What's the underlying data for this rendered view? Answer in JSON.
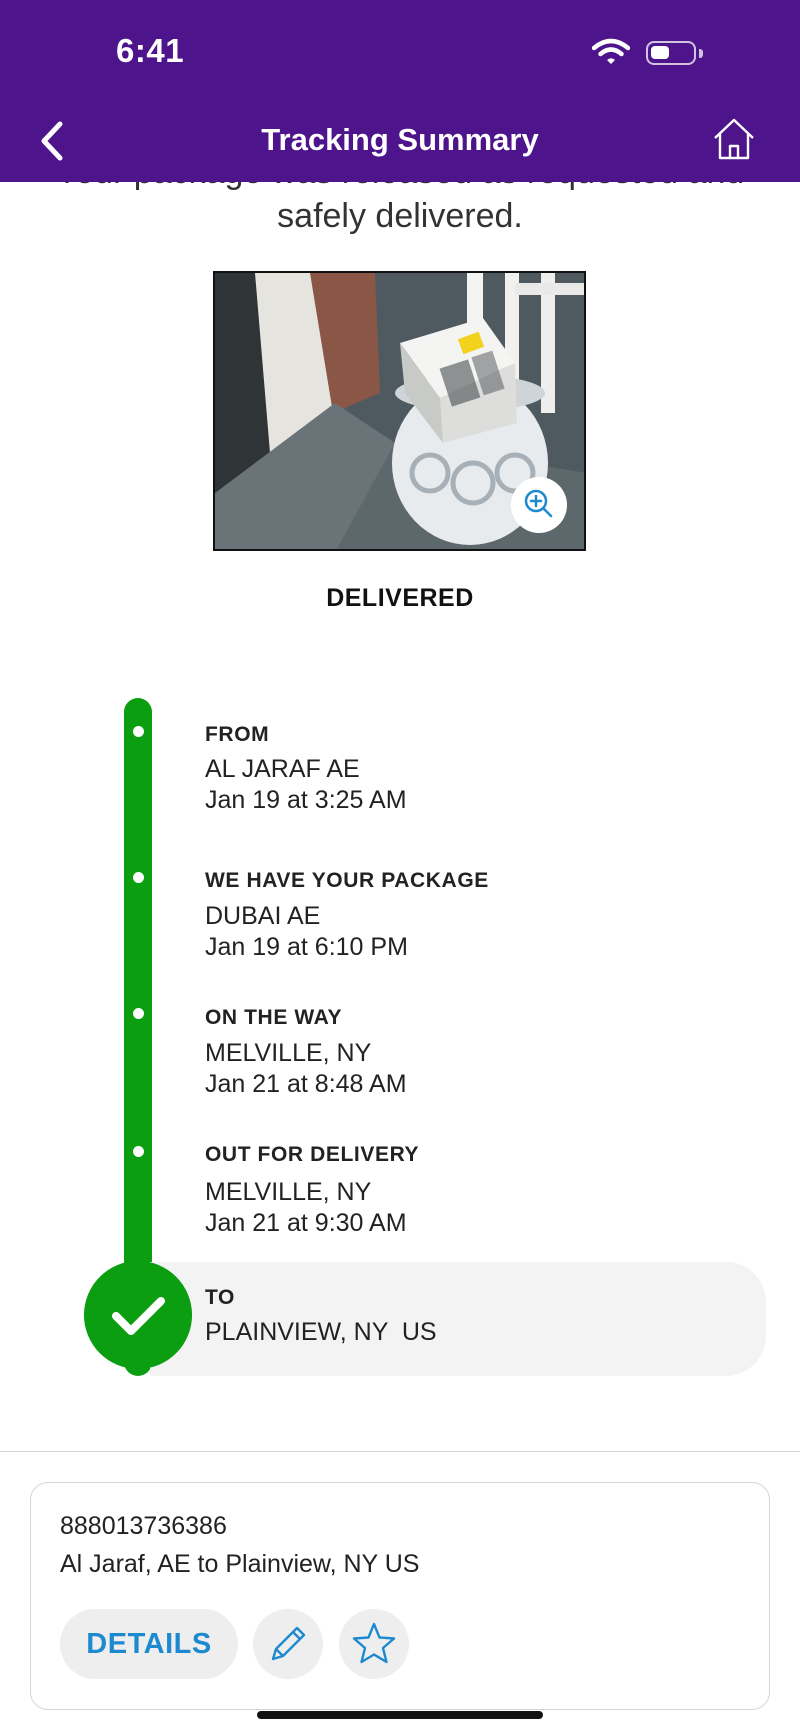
{
  "status_bar": {
    "time": "6:41"
  },
  "nav": {
    "title": "Tracking Summary",
    "back_icon": "chevron-left-icon",
    "home_icon": "home-icon"
  },
  "message": {
    "line1": "Your package was released as requested and",
    "line2": "safely delivered."
  },
  "photo": {
    "zoom_icon": "zoom-in-icon"
  },
  "status": "DELIVERED",
  "timeline": [
    {
      "heading": "FROM",
      "location": "AL JARAF AE",
      "time": "Jan 19 at 3:25 AM"
    },
    {
      "heading": "WE HAVE YOUR PACKAGE",
      "location": "DUBAI AE",
      "time": "Jan 19 at 6:10 PM"
    },
    {
      "heading": "ON THE WAY",
      "location": "MELVILLE, NY",
      "time": "Jan 21 at 8:48 AM"
    },
    {
      "heading": "OUT FOR DELIVERY",
      "location": "MELVILLE, NY",
      "time": "Jan 21 at 9:30 AM"
    },
    {
      "heading": "TO",
      "location": "PLAINVIEW, NY  US"
    }
  ],
  "card": {
    "tracking_number": "888013736386",
    "route": "Al Jaraf, AE to Plainview, NY US",
    "details_label": "DETAILS",
    "edit_icon": "pencil-icon",
    "favorite_icon": "star-icon"
  },
  "colors": {
    "header": "#4d148c",
    "timeline": "#0c9e11",
    "link": "#1d8ad0"
  }
}
